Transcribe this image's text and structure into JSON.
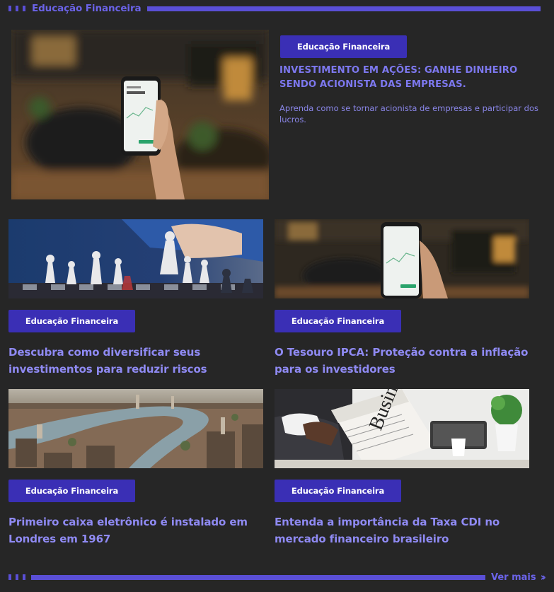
{
  "section": {
    "title": "Educação Financeira"
  },
  "featured": {
    "badge": "Educação Financeira",
    "title": "INVESTIMENTO EM AÇÕES: GANHE DINHEIRO SENDO ACIONISTA DAS EMPRESAS.",
    "description": "Aprenda como se tornar acionista de empresas e participar dos lucros.",
    "image": "smartphone-stock-app-photo"
  },
  "cards": [
    {
      "badge": "Educação Financeira",
      "title": "Descubra como diversificar seus investimentos para reduzir riscos",
      "image": "chess-pieces-photo"
    },
    {
      "badge": "Educação Financeira",
      "title": "O Tesouro IPCA: Proteção contra a inflação para os investidores",
      "image": "smartphone-stock-app-photo"
    },
    {
      "badge": "Educação Financeira",
      "title": "Primeiro caixa eletrônico é instalado em Londres em 1967",
      "image": "london-aerial-photo"
    },
    {
      "badge": "Educação Financeira",
      "title": "Entenda a importância da Taxa CDI no mercado financeiro brasileiro",
      "image": "business-newspaper-photo"
    }
  ],
  "footer": {
    "see_more": "Ver mais",
    "icon": "double-chevron-right-icon"
  },
  "colors": {
    "accent": "#5a4fd6",
    "badge": "#3a2fb5",
    "background": "#262626",
    "title": "#8f8af3"
  }
}
